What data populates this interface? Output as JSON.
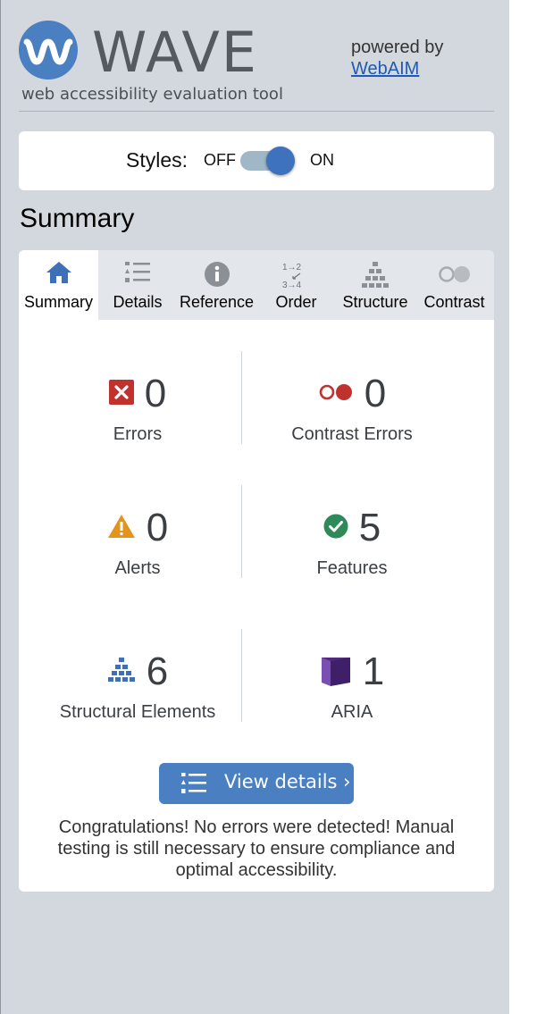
{
  "header": {
    "logo_word": "WAVE",
    "tagline": "web accessibility evaluation tool",
    "powered_by": "powered by",
    "webaim_link": "WebAIM"
  },
  "styles": {
    "label": "Styles:",
    "off": "OFF",
    "on": "ON",
    "state": "on"
  },
  "panel": {
    "heading": "Summary"
  },
  "tabs": [
    {
      "label": "Summary",
      "icon": "home-icon",
      "active": true
    },
    {
      "label": "Details",
      "icon": "list-icon"
    },
    {
      "label": "Reference",
      "icon": "info-icon"
    },
    {
      "label": "Order",
      "icon": "order-icon"
    },
    {
      "label": "Structure",
      "icon": "structure-icon"
    },
    {
      "label": "Contrast",
      "icon": "contrast-icon"
    }
  ],
  "stats": {
    "errors": {
      "count": "0",
      "label": "Errors",
      "icon": "error-icon"
    },
    "contrast_errors": {
      "count": "0",
      "label": "Contrast Errors",
      "icon": "contrast-error-icon"
    },
    "alerts": {
      "count": "0",
      "label": "Alerts",
      "icon": "alert-icon"
    },
    "features": {
      "count": "5",
      "label": "Features",
      "icon": "feature-icon"
    },
    "structural": {
      "count": "6",
      "label": "Structural Elements",
      "icon": "structure-icon"
    },
    "aria": {
      "count": "1",
      "label": "ARIA",
      "icon": "aria-icon"
    }
  },
  "view_details": {
    "label": "View details ›"
  },
  "message": "Congratulations! No errors were detected! Manual testing is still necessary to ensure compliance and optimal accessibility.",
  "colors": {
    "accent": "#4a7fc1",
    "error": "#c0322d",
    "alert": "#e2941d",
    "feature": "#2f8a5a",
    "aria": "#4f2a7f",
    "sidebar_bg": "#d3d8de"
  }
}
